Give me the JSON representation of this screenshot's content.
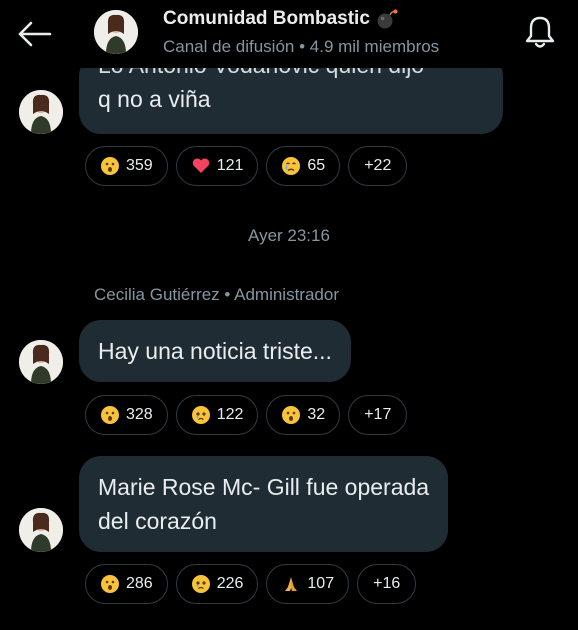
{
  "header": {
    "title": "Comunidad Bombastic",
    "subtitle": "Canal de difusión • 4.9 mil miembros",
    "icons": {
      "back": "arrow-left-icon",
      "notifications": "bell-icon",
      "title_emoji": "bomb-icon"
    }
  },
  "messages": [
    {
      "text_partial_top": "Lo Antonio Vodanovic quien dijo",
      "text_line": "q no a viña",
      "reactions": [
        {
          "emoji": "surprised-face-icon",
          "count": "359"
        },
        {
          "emoji": "heart-icon",
          "count": "121"
        },
        {
          "emoji": "crying-face-icon",
          "count": "65"
        },
        {
          "count": "+22"
        }
      ]
    },
    {
      "text": "Hay una noticia triste...",
      "reactions": [
        {
          "emoji": "surprised-face-icon",
          "count": "328"
        },
        {
          "emoji": "sad-face-icon",
          "count": "122"
        },
        {
          "emoji": "surprised-face-icon",
          "count": "32"
        },
        {
          "count": "+17"
        }
      ]
    },
    {
      "text_line1": "Marie Rose Mc- Gill fue operada",
      "text_line2": "del corazón",
      "reactions": [
        {
          "emoji": "surprised-face-icon",
          "count": "286"
        },
        {
          "emoji": "sad-face-icon",
          "count": "226"
        },
        {
          "emoji": "praying-hands-icon",
          "count": "107"
        },
        {
          "count": "+16"
        }
      ]
    }
  ],
  "date_separator": "Ayer 23:16",
  "sender_line": "Cecilia Gutiérrez • Administrador",
  "colors": {
    "background": "#000000",
    "bubble": "#202c33",
    "secondary_text": "#8696a0",
    "pill_border": "#2f3b43"
  }
}
